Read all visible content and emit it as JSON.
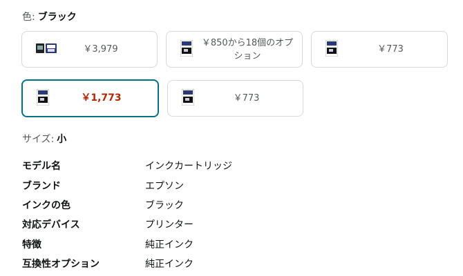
{
  "color": {
    "label": "色:",
    "value": "ブラック"
  },
  "swatches": [
    {
      "price": "￥3,979",
      "thumb_icon": "ink-twin-pack-icon"
    },
    {
      "price": "￥850から18個のオプション",
      "thumb_icon": "ink-cartridge-icon"
    },
    {
      "price": "￥773",
      "thumb_icon": "ink-cartridge-icon"
    },
    {
      "price": "￥1,773",
      "thumb_icon": "ink-cartridge-icon",
      "selected": true
    },
    {
      "price": "￥773",
      "thumb_icon": "ink-cartridge-icon"
    }
  ],
  "size": {
    "label": "サイズ:",
    "value": "小"
  },
  "specs": [
    {
      "key": "モデル名",
      "value": "インクカートリッジ"
    },
    {
      "key": "ブランド",
      "value": "エプソン"
    },
    {
      "key": "インクの色",
      "value": "ブラック"
    },
    {
      "key": "対応デバイス",
      "value": "プリンター"
    },
    {
      "key": "特徴",
      "value": "純正インク"
    },
    {
      "key": "互換性オプション",
      "value": "純正インク"
    }
  ],
  "colors": {
    "selected_border": "#007185",
    "sale_price": "#b12704",
    "border": "#d5d9d9"
  }
}
